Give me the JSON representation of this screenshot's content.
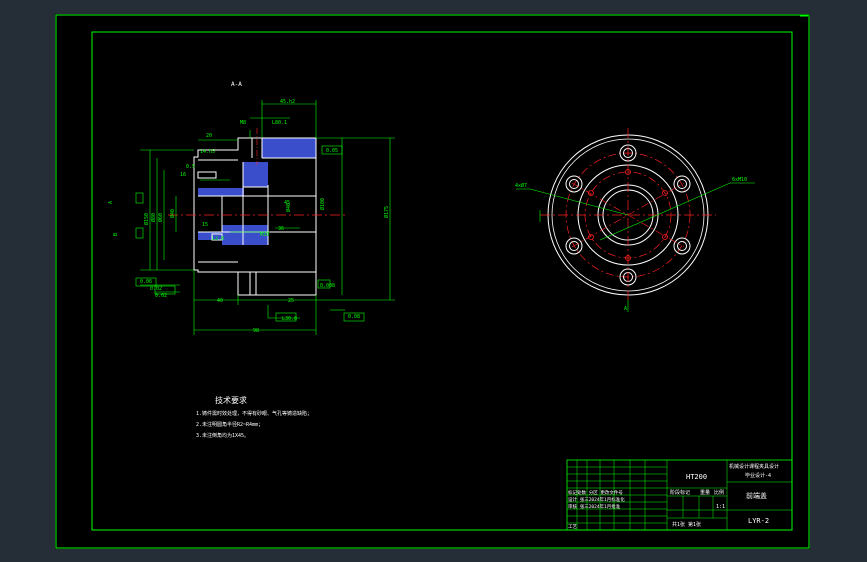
{
  "colors": {
    "background_frame": "#252d36",
    "model_space": "#000000",
    "border": "#00ff00",
    "geometry": "#ffffff",
    "dimension": "#00ff00",
    "center_line": "#ff2020",
    "hatch": "#3a4ecc",
    "text": "#ffffff"
  },
  "section": {
    "label": "A-A"
  },
  "dimensions": {
    "top_width": "45.h2",
    "d1": "20",
    "d2": "14.h5",
    "d3": "M8",
    "d4": "L80.1",
    "d5": "45",
    "d6": "36",
    "d7": "50",
    "d8": "M10",
    "d9": "40",
    "d10": "98",
    "d11": "70",
    "d12": "L30.8",
    "d13": "15",
    "d14": "L2.8",
    "d15": "25",
    "d16": "16",
    "d17": "0.5",
    "d18": "Ø150",
    "d19": "Ø40",
    "d20": "Ø100",
    "right_overall": "Ø175",
    "tol1": "0.05",
    "tol2": "0.02",
    "tol3": "0.02",
    "datum_a": "A",
    "datum_b": "B",
    "left_note": "Ø80",
    "left_note2": "Ø60",
    "left_note3": "Ø150",
    "left_note4": "Ø40",
    "bottom_tol1": "0.008",
    "bottom_tol2": "0.08",
    "bottom_tol3": "0.06"
  },
  "front_view": {
    "left_label": "4xØ7",
    "right_label": "6xM10",
    "bottom_label": "A"
  },
  "tech_requirements": {
    "title": "技术要求",
    "items": [
      "1.铸件需时效处理，不得有砂眼、气孔等铸造缺陷；",
      "2.未注明圆角半径R2~R4mm；",
      "3.未注倒角均为1X45。"
    ]
  },
  "title_block": {
    "material": "HT200",
    "project": "机械设计课程夹具设计",
    "project2": "毕业设计-4",
    "part_name": "前端盖",
    "drawing_no": "LYR-2",
    "stage_label": "阶段标记",
    "weight_label": "重量",
    "scale_label": "比例",
    "scale": "1:1",
    "sheet_text": "共1张  第1张",
    "left_rows": [
      "标记处数  分区  更改文件号",
      "设计  张三2024年1月标准化",
      "审核  张三2024年1月批准"
    ],
    "craft_label": "工艺"
  }
}
